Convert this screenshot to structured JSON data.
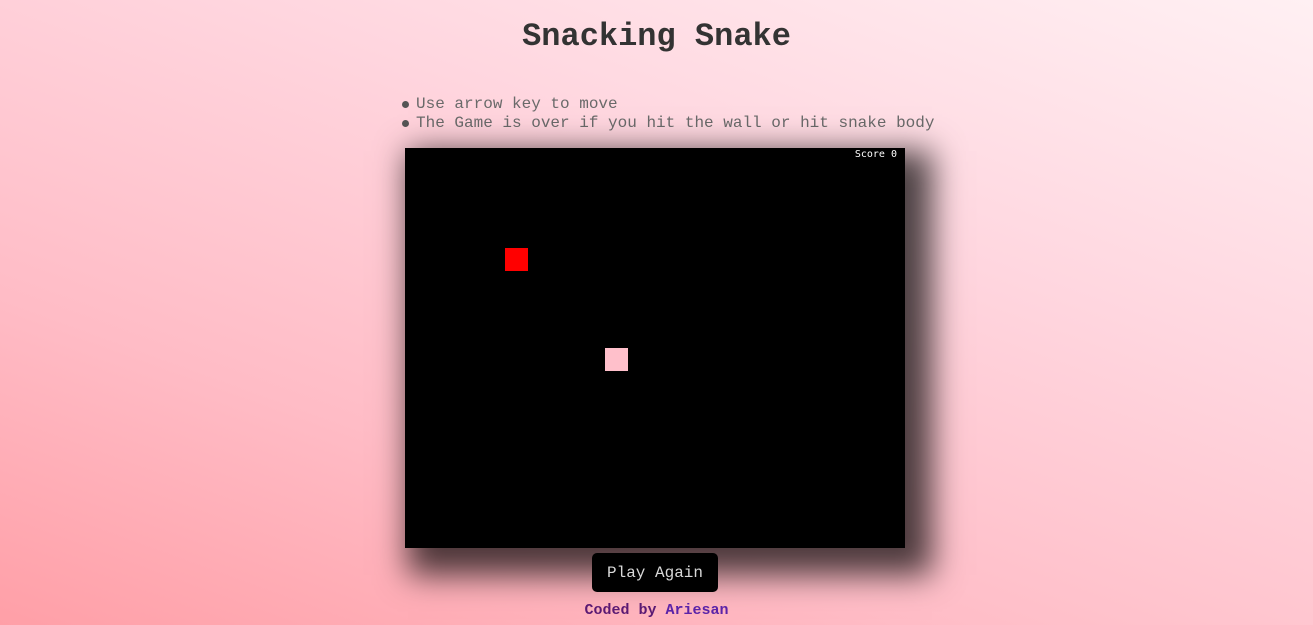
{
  "page": {
    "title": "Snacking Snake"
  },
  "instructions": [
    "Use arrow key to move",
    "The Game is over if you hit the wall or hit snake body"
  ],
  "game": {
    "score_label": "Score 0",
    "colors": {
      "board": "#000000",
      "food": "#ff0000",
      "snake": "#ffc0cb"
    }
  },
  "controls": {
    "play_again_label": "Play Again"
  },
  "footer": {
    "prefix": "Coded by",
    "author": "Ariesan"
  }
}
